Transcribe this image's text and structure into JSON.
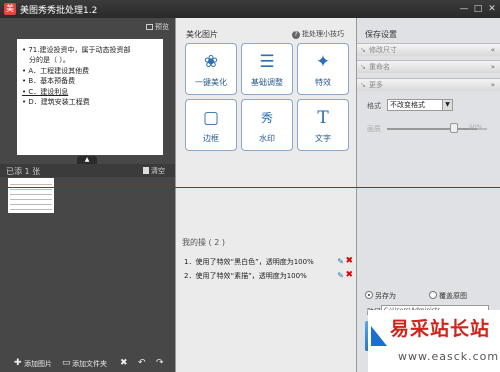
{
  "window": {
    "app_icon": "meitu-icon",
    "title": "美图秀秀批处理1.2",
    "min_symbol": "—",
    "max_symbol": "□",
    "close_symbol": "✕"
  },
  "left_panel": {
    "preview_label": "预览",
    "slide_lines": [
      "• 71.建设投资中，属于动态投资部",
      "分的是（    ）。",
      "• A．工程建设其他费",
      "• B．基本预备费",
      "• C．建设利息",
      "• D．建筑安装工程费"
    ],
    "collapse_symbol": "▲",
    "added_count": "已添 1 张",
    "clear_label": "清空",
    "bottom": {
      "add_image": "添加图片",
      "add_folder": "添加文件夹",
      "delete_symbol": "✖",
      "rotate_left_symbol": "↶",
      "rotate_right_symbol": "↷"
    }
  },
  "center_panel": {
    "title": "美化图片",
    "tips": "批处理小技巧",
    "tools": [
      {
        "label": "一键美化",
        "icon": "flower-icon",
        "glyph": "❀"
      },
      {
        "label": "基础调整",
        "icon": "sliders-icon",
        "glyph": "☰"
      },
      {
        "label": "特效",
        "icon": "magic-wand-icon",
        "glyph": "✦"
      },
      {
        "label": "边框",
        "icon": "frame-icon",
        "glyph": "▢"
      },
      {
        "label": "水印",
        "icon": "watermark-icon",
        "glyph": "秀"
      },
      {
        "label": "文字",
        "icon": "text-icon",
        "glyph": "T"
      }
    ],
    "ops_title": "我的操  ( 2 )",
    "operations": [
      "1．使用了特效“黑白色”，透明度为100%",
      "2．使用了特效“素描”，透明度为100%"
    ],
    "edit_symbol": "✎",
    "delete_symbol": "✖"
  },
  "right_panel": {
    "title": "保存设置",
    "accordion": [
      {
        "label": "修改尺寸",
        "chevron": "«"
      },
      {
        "label": "重命名",
        "chevron": "»"
      },
      {
        "label": "更多",
        "chevron": "»"
      }
    ],
    "format_label": "格式",
    "format_value": "不改变格式",
    "format_arrow": "▼",
    "quality_label": "画质",
    "quality_value": "90%",
    "quality_fraction": 0.9,
    "save_as": "另存为",
    "overwrite": "覆盖原图",
    "path_label": "路径",
    "path_value": "C:\\Users\\Administr"
  },
  "watermark": {
    "text": "易采站长站",
    "url": "www.easck.com"
  }
}
